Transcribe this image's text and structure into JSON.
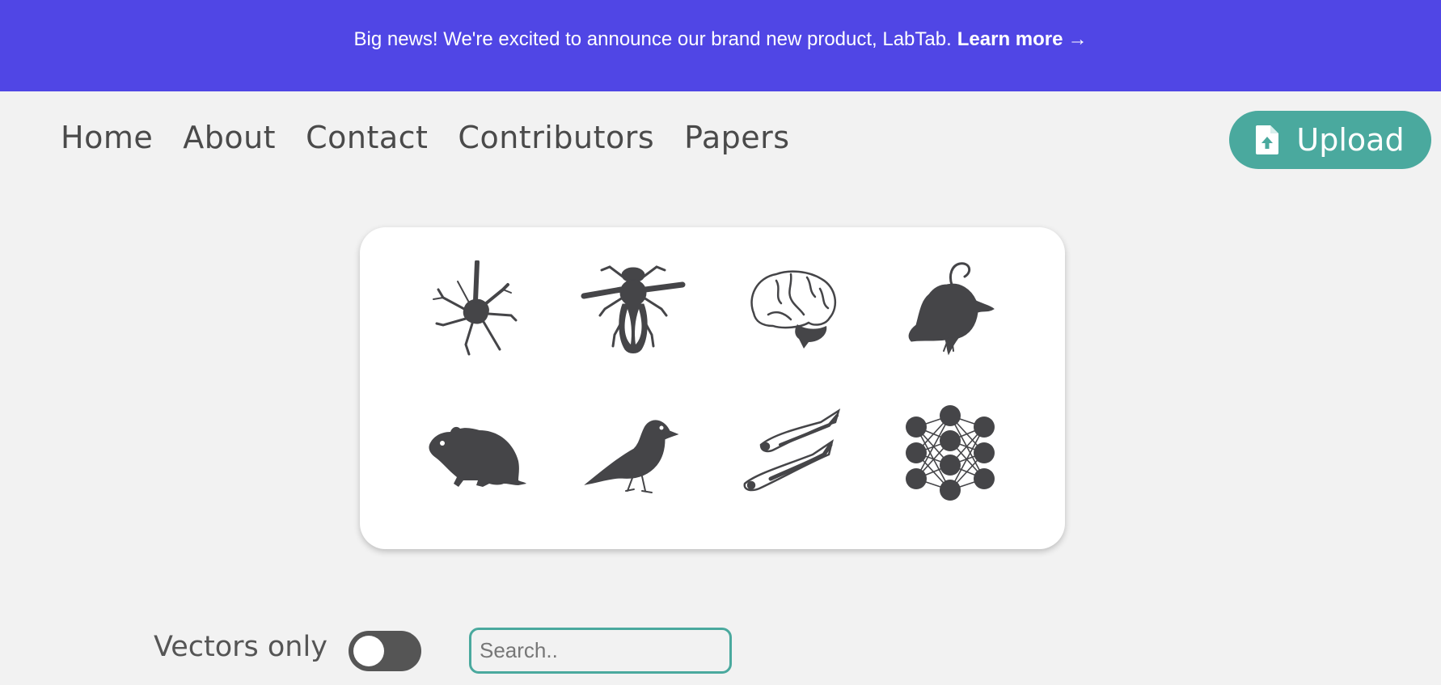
{
  "banner": {
    "text": "Big news! We're excited to announce our brand new product, LabTab.",
    "link_text": "Learn more",
    "arrow": "→"
  },
  "nav": {
    "items": [
      {
        "label": "Home"
      },
      {
        "label": "About"
      },
      {
        "label": "Contact"
      },
      {
        "label": "Contributors"
      },
      {
        "label": "Papers"
      }
    ],
    "upload_label": "Upload",
    "upload_icon": "file-upload-icon"
  },
  "species_grid": {
    "icons": [
      "neuron-icon",
      "fly-icon",
      "brain-icon",
      "mouse-top-icon",
      "rat-icon",
      "finch-icon",
      "zebrafish-icon",
      "neural-network-icon"
    ]
  },
  "filters": {
    "vectors_label": "Vectors only",
    "vectors_toggle_on": false,
    "search_placeholder": "Search.."
  },
  "colors": {
    "banner": "#5046e5",
    "accent": "#4aa99e",
    "icon": "#454548",
    "background": "#f2f2f2"
  }
}
